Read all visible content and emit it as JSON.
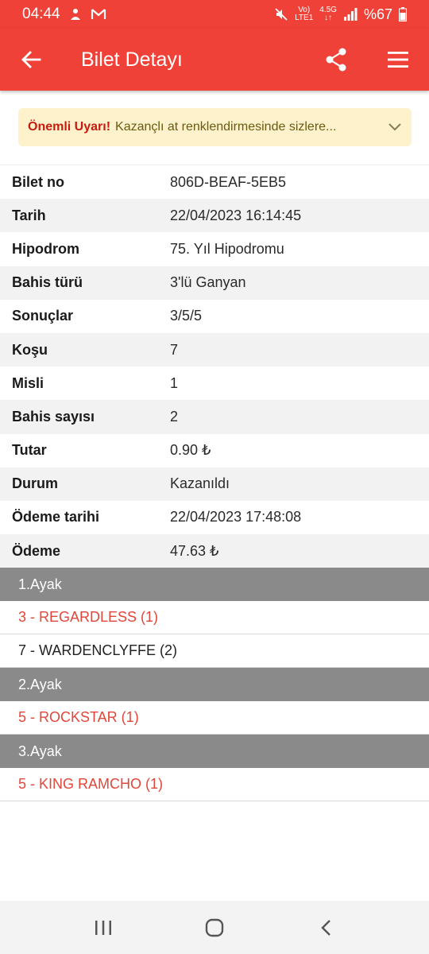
{
  "status_bar": {
    "time": "04:44",
    "network_top": "Vo)",
    "network_bottom": "LTE1",
    "data_top": "4.5G",
    "data_bottom": "↓↑",
    "battery": "%67"
  },
  "app_bar": {
    "title": "Bilet Detayı",
    "icons": [
      "back-arrow-icon",
      "share-icon",
      "menu-icon"
    ]
  },
  "warning": {
    "title": "Önemli Uyarı!",
    "message": "Kazançlı at renklendirmesinde sizlere..."
  },
  "details": [
    {
      "label": "Bilet no",
      "value": "806D-BEAF-5EB5"
    },
    {
      "label": "Tarih",
      "value": "22/04/2023 16:14:45"
    },
    {
      "label": "Hipodrom",
      "value": "75. Yıl Hipodromu"
    },
    {
      "label": "Bahis türü",
      "value": "3'lü Ganyan"
    },
    {
      "label": "Sonuçlar",
      "value": "3/5/5"
    },
    {
      "label": "Koşu",
      "value": "7"
    },
    {
      "label": "Misli",
      "value": "1"
    },
    {
      "label": "Bahis sayısı",
      "value": "2"
    },
    {
      "label": "Tutar",
      "value": "0.90 ₺"
    },
    {
      "label": "Durum",
      "value": "Kazanıldı"
    },
    {
      "label": "Ödeme tarihi",
      "value": "22/04/2023 17:48:08"
    },
    {
      "label": "Ödeme",
      "value": "47.63 ₺"
    }
  ],
  "legs": [
    {
      "title": "1.Ayak",
      "horses": [
        {
          "text": "3 - REGARDLESS (1)",
          "won": true
        },
        {
          "text": "7 - WARDENCLYFFE (2)",
          "won": false
        }
      ]
    },
    {
      "title": "2.Ayak",
      "horses": [
        {
          "text": "5 - ROCKSTAR (1)",
          "won": true
        }
      ]
    },
    {
      "title": "3.Ayak",
      "horses": [
        {
          "text": "5 - KING RAMCHO (1)",
          "won": true
        }
      ]
    }
  ],
  "colors": {
    "primary": "#ef4137",
    "win_text": "#e2463a",
    "leg_header": "#8a8a8a",
    "warning_bg": "#fdf2cc"
  }
}
